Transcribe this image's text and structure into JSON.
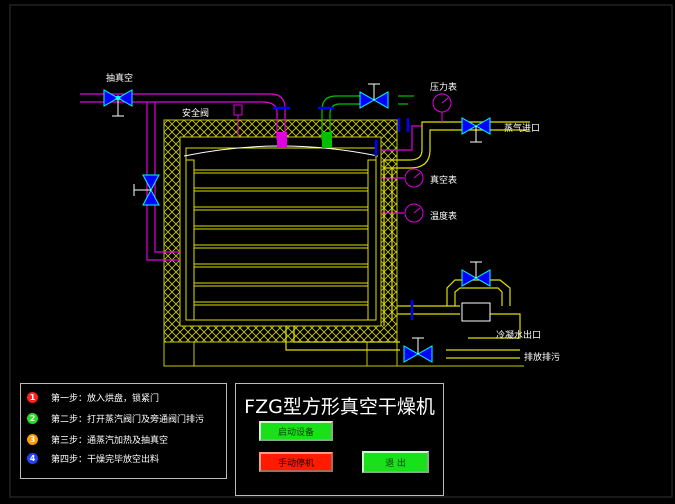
{
  "labels": {
    "vacuum_pump": "抽真空",
    "safety_valve": "安全阀",
    "pressure_gauge": "压力表",
    "steam_inlet": "蒸气进口",
    "vacuum_gauge": "真空表",
    "thermometer": "温度表",
    "cooling_water_outlet": "冷凝水出口",
    "drain": "排放排污"
  },
  "steps": [
    {
      "num": "1",
      "color": "#ff2020",
      "text": "第一步：放入烘盘，锁紧门"
    },
    {
      "num": "2",
      "color": "#22dd22",
      "text": "第二步：打开蒸汽阀门及旁通阀门排污"
    },
    {
      "num": "3",
      "color": "#ff9900",
      "text": "第三步：通蒸汽加热及抽真空"
    },
    {
      "num": "4",
      "color": "#2244ff",
      "text": "第四步：干燥完毕放空出料"
    }
  ],
  "control": {
    "title": "FZG型方形真空干燥机",
    "start_label": "启动设备",
    "manual_stop_label": "手动停机",
    "exit_label": "退 出"
  },
  "colors": {
    "steam_pipe": "#e000e0",
    "water_pipe": "#e0e000",
    "vacuum_pipe": "#00c000",
    "valve": "#0000ff",
    "hatch": "#c8c800"
  }
}
